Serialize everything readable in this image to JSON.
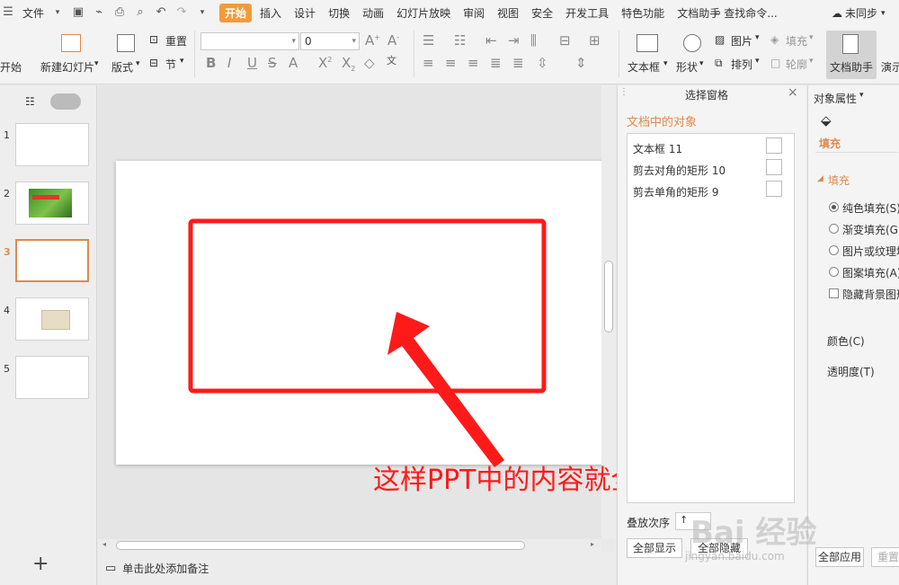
{
  "menubar": {
    "file": "文件",
    "tabs": [
      "开始",
      "插入",
      "设计",
      "切换",
      "动画",
      "幻灯片放映",
      "审阅",
      "视图",
      "安全",
      "开发工具",
      "特色功能",
      "文档助手"
    ],
    "active_tab": "开始",
    "search": "查找命令...",
    "sync": "未同步"
  },
  "ribbon": {
    "start_partial": "开始",
    "new_slide": "新建幻灯片",
    "layout": "版式",
    "reset": "重置",
    "section": "节",
    "font_size": "0",
    "textbox": "文本框",
    "shape": "形状",
    "picture": "图片",
    "fill": "填充",
    "arrange": "排列",
    "outline": "轮廓",
    "doc_assistant": "文档助手",
    "present_partial": "演示",
    "phonetic": "wén\n文"
  },
  "thumbs": {
    "numbers": [
      "1",
      "2",
      "3",
      "4",
      "5"
    ],
    "selected": "3"
  },
  "notes": {
    "placeholder": "单击此处添加备注"
  },
  "caption": "这样PPT中的内容就全部隐藏了",
  "selection_pane": {
    "title": "选择窗格",
    "heading": "文档中的对象",
    "objects": [
      "文本框 11",
      "剪去对角的矩形 10",
      "剪去单角的矩形 9"
    ],
    "order_label": "叠放次序",
    "show_all": "全部显示",
    "hide_all": "全部隐藏"
  },
  "properties_pane": {
    "title": "对象属性",
    "fill_tab": "填充",
    "fill_section": "填充",
    "options": [
      "纯色填充(S)",
      "渐变填充(G)",
      "图片或纹理填充",
      "图案填充(A)"
    ],
    "hide_bg": "隐藏背景图形",
    "color": "颜色(C)",
    "transparency": "透明度(T)",
    "apply_all": "全部应用",
    "reset_partial": "重置背"
  },
  "watermark": {
    "brand": "Bai 经验",
    "url": "jingyan.baidu.com"
  },
  "colors": {
    "accent": "#f29b3c",
    "annotation_red": "#ff1a1a",
    "orange_heading": "#e08a4c"
  }
}
